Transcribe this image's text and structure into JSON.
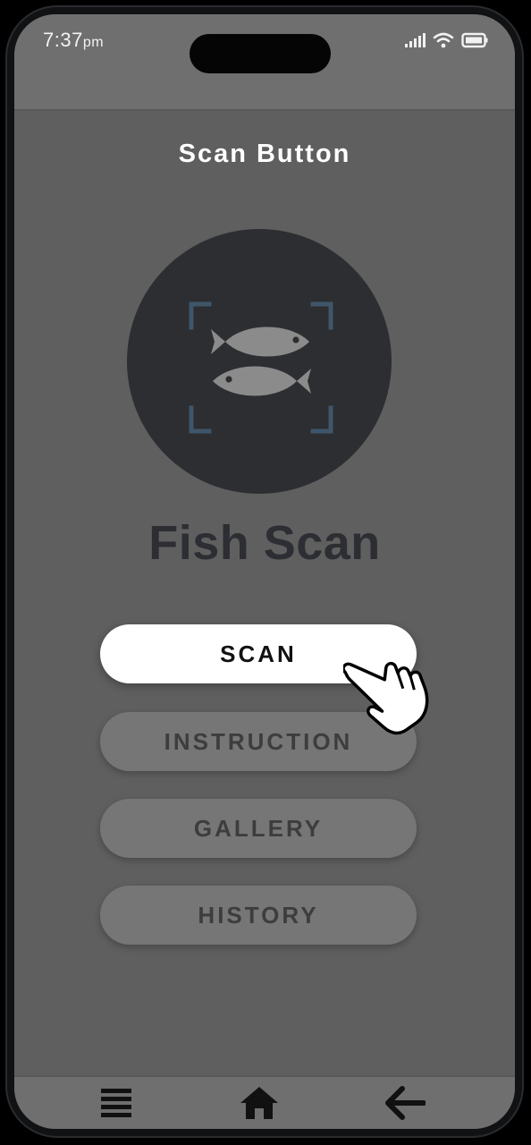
{
  "status_bar": {
    "time": "7:37",
    "ampm": "pm",
    "icons": [
      "signal-icon",
      "wifi-icon",
      "battery-icon"
    ]
  },
  "page_title": "Scan Button",
  "app": {
    "logo_icon": "fish-scan-icon",
    "name": "Fish Scan"
  },
  "menu": {
    "scan": "SCAN",
    "instruction": "INSTRUCTION",
    "gallery": "GALLERY",
    "history": "HISTORY"
  },
  "bottom_nav": {
    "icons": [
      "menu-icon",
      "home-icon",
      "back-arrow-icon"
    ]
  },
  "colors": {
    "screen_bg": "#5f5f5f",
    "bar_bg": "#6f6f6f",
    "logo_bg": "#2c2e31",
    "frame_accent": "#3f566a",
    "active_button": "#ffffff",
    "inactive_button": "#767676"
  }
}
